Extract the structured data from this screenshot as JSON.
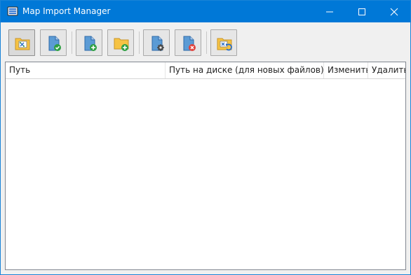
{
  "window": {
    "title": "Map Import Manager"
  },
  "toolbar": {
    "buttons": [
      {
        "name": "import-map-button",
        "icon": "folder-map-icon"
      },
      {
        "name": "approve-file-button",
        "icon": "file-check-icon"
      },
      {
        "name": "add-file-button",
        "icon": "file-add-icon"
      },
      {
        "name": "add-folder-button",
        "icon": "folder-add-icon"
      },
      {
        "name": "file-settings-button",
        "icon": "file-gear-icon"
      },
      {
        "name": "remove-file-button",
        "icon": "file-remove-icon"
      },
      {
        "name": "update-map-button",
        "icon": "folder-map-refresh-icon"
      }
    ]
  },
  "grid": {
    "columns": [
      "Путь",
      "Путь на диске (для новых файлов)",
      "Изменить",
      "Удалить"
    ],
    "rows": []
  },
  "colors": {
    "titlebar": "#0078d7",
    "folder": "#f6c343",
    "file": "#5b9bd5",
    "accent_green": "#2ea043",
    "accent_red": "#e0443e"
  }
}
